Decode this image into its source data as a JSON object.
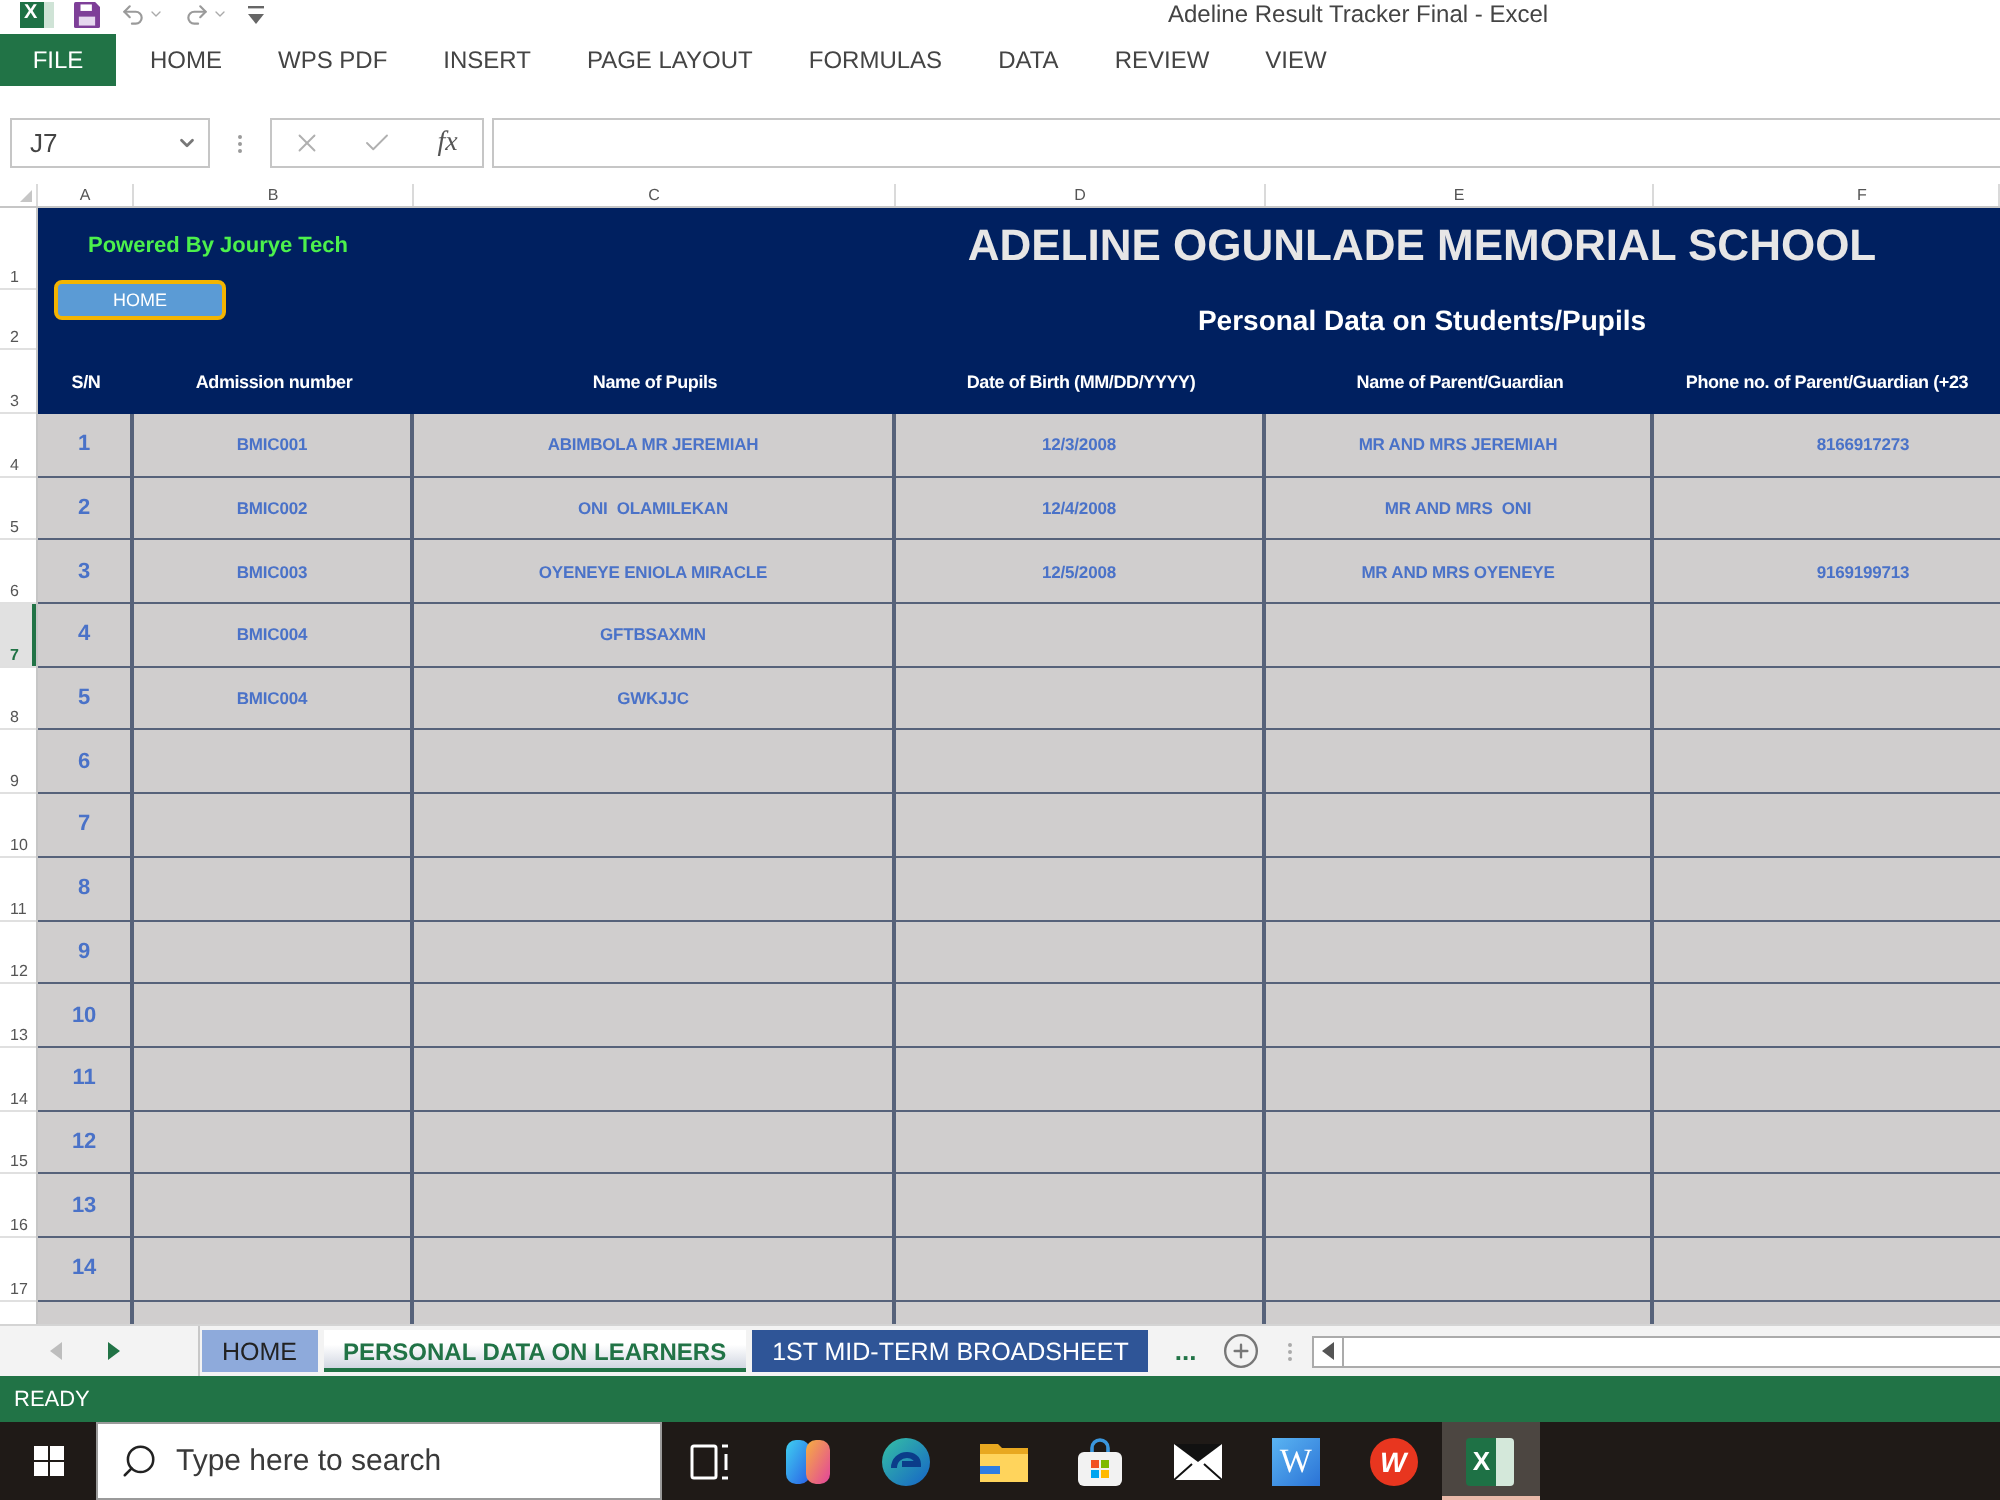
{
  "window": {
    "title": "Adeline Result Tracker Final - Excel",
    "app_glyph": "X"
  },
  "ribbon_tabs": [
    {
      "label": "FILE",
      "kind": "file"
    },
    {
      "label": "HOME",
      "kind": "tab"
    },
    {
      "label": "WPS PDF",
      "kind": "tab"
    },
    {
      "label": "INSERT",
      "kind": "tab"
    },
    {
      "label": "PAGE LAYOUT",
      "kind": "tab"
    },
    {
      "label": "FORMULAS",
      "kind": "tab"
    },
    {
      "label": "DATA",
      "kind": "tab"
    },
    {
      "label": "REVIEW",
      "kind": "tab"
    },
    {
      "label": "VIEW",
      "kind": "tab"
    }
  ],
  "name_box": {
    "value": "J7"
  },
  "formula_bar": {
    "function_label": "fx"
  },
  "column_letters": [
    "A",
    "B",
    "C",
    "D",
    "E",
    "F"
  ],
  "row_headers": [
    {
      "label": "1",
      "selected": false
    },
    {
      "label": "2",
      "selected": false
    },
    {
      "label": "3",
      "selected": false
    },
    {
      "label": "4",
      "selected": false
    },
    {
      "label": "5",
      "selected": false
    },
    {
      "label": "6",
      "selected": false
    },
    {
      "label": "7",
      "selected": true
    },
    {
      "label": "8",
      "selected": false
    },
    {
      "label": "9",
      "selected": false
    },
    {
      "label": "10",
      "selected": false
    },
    {
      "label": "11",
      "selected": false
    },
    {
      "label": "12",
      "selected": false
    },
    {
      "label": "13",
      "selected": false
    },
    {
      "label": "14",
      "selected": false
    },
    {
      "label": "15",
      "selected": false
    },
    {
      "label": "16",
      "selected": false
    },
    {
      "label": "17",
      "selected": false
    }
  ],
  "banner": {
    "credit": "Powered By Jourye Tech",
    "home_button": "HOME",
    "title": "ADELINE OGUNLADE MEMORIAL SCHOOL",
    "subtitle": "Personal Data on Students/Pupils"
  },
  "table": {
    "columns": [
      "S/N",
      "Admission number",
      "Name of Pupils",
      "Date of Birth (MM/DD/YYYY)",
      "Name of Parent/Guardian",
      "Phone no. of Parent/Guardian (+23"
    ],
    "rows": [
      {
        "sn": "1",
        "admission_number": "BMIC001",
        "pupil_name": "ABIMBOLA MR JEREMIAH",
        "date_of_birth": "12/3/2008",
        "parent_name": "MR AND MRS JEREMIAH",
        "phone": "8166917273"
      },
      {
        "sn": "2",
        "admission_number": "BMIC002",
        "pupil_name": "ONI  OLAMILEKAN",
        "date_of_birth": "12/4/2008",
        "parent_name": "MR AND MRS  ONI"
      },
      {
        "sn": "3",
        "admission_number": "BMIC003",
        "pupil_name": "OYENEYE ENIOLA MIRACLE",
        "date_of_birth": "12/5/2008",
        "parent_name": "MR AND MRS OYENEYE",
        "phone": "9169199713"
      },
      {
        "sn": "4",
        "admission_number": "BMIC004",
        "pupil_name": "GFTBSAXMN"
      },
      {
        "sn": "5",
        "admission_number": "BMIC004",
        "pupil_name": "GWKJJC"
      },
      {
        "sn": "6"
      },
      {
        "sn": "7"
      },
      {
        "sn": "8"
      },
      {
        "sn": "9"
      },
      {
        "sn": "10"
      },
      {
        "sn": "11"
      },
      {
        "sn": "12"
      },
      {
        "sn": "13"
      },
      {
        "sn": "14"
      }
    ]
  },
  "sheet_tabs": [
    {
      "label": "HOME",
      "selected": false,
      "color": "#8eaadb"
    },
    {
      "label": "PERSONAL DATA ON LEARNERS",
      "selected": true,
      "color": "#c9cfdc"
    },
    {
      "label": "1ST MID-TERM BROADSHEET",
      "selected": false,
      "color": "#2f5597"
    }
  ],
  "more_tabs": "...",
  "status_bar": {
    "text": "READY"
  },
  "taskbar": {
    "search": {
      "placeholder": "Type here to search"
    },
    "apps": [
      {
        "kind": "task_view",
        "selected": false
      },
      {
        "kind": "copilot",
        "selected": false
      },
      {
        "kind": "edge",
        "selected": false
      },
      {
        "kind": "explorer",
        "selected": false
      },
      {
        "kind": "store",
        "selected": false
      },
      {
        "kind": "mail",
        "selected": false
      },
      {
        "kind": "word",
        "glyph": "W",
        "selected": false
      },
      {
        "kind": "wps",
        "glyph": "W",
        "selected": false
      },
      {
        "kind": "excel",
        "glyph": "X",
        "selected": true
      }
    ]
  }
}
